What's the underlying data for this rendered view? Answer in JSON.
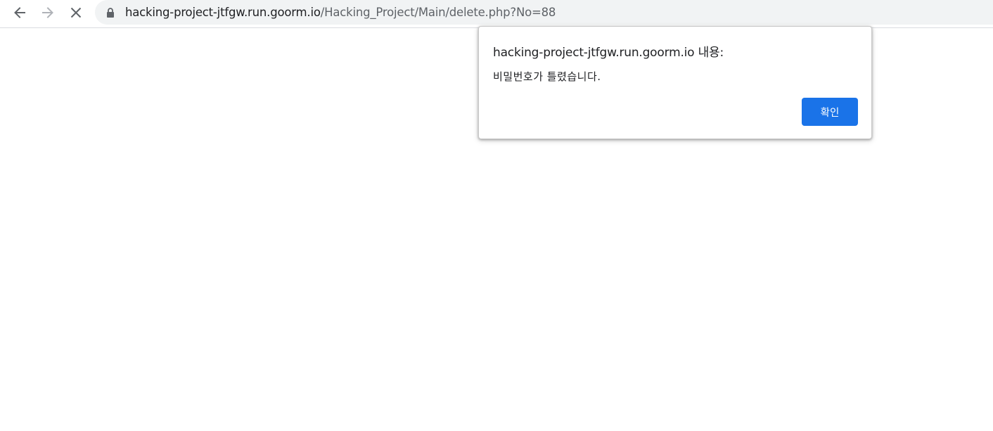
{
  "browser": {
    "url": {
      "host": "hacking-project-jtfgw.run.goorm.io",
      "path": "/Hacking_Project/Main/delete.php?No=88"
    },
    "icons": {
      "back": "back-arrow-icon",
      "forward": "forward-arrow-icon",
      "stop": "stop-loading-icon",
      "lock": "lock-icon"
    }
  },
  "dialog": {
    "title": "hacking-project-jtfgw.run.goorm.io 내용:",
    "message": "비밀번호가 틀렸습니다.",
    "ok_label": "확인"
  },
  "colors": {
    "accent": "#1a73e8",
    "omnibox_bg": "#f1f3f4",
    "host_text": "#202124",
    "path_text": "#5f6368"
  }
}
